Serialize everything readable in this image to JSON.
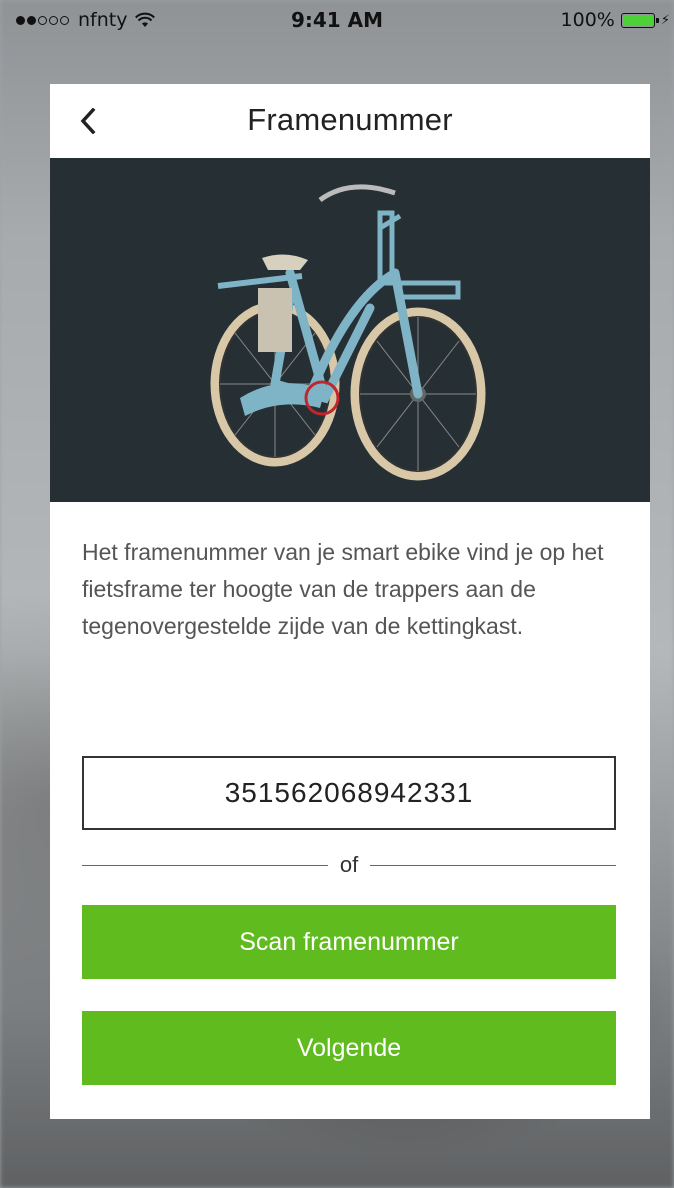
{
  "status_bar": {
    "carrier": "nfnty",
    "time": "9:41 AM",
    "battery": "100%",
    "signal_bars_filled": 2,
    "signal_bars_total": 5,
    "battery_level": 1.0,
    "icons": [
      "wifi-icon",
      "battery-icon",
      "charging-bolt-icon"
    ]
  },
  "header": {
    "back_icon": "chevron-left-icon",
    "title": "Framenummer"
  },
  "hero": {
    "image": "bike-photo",
    "highlight": "red-circle-marker"
  },
  "description": "Het framenummer van je smart ebike vind je op het fietsframe ter hoogte van de trappers aan de tegenovergestelde zijde van de kettingkast.",
  "form": {
    "frame_number_value": "351562068942331",
    "divider_label": "of",
    "scan_button_label": "Scan framenummer",
    "next_button_label": "Volgende"
  },
  "colors": {
    "accent": "#5fbb1e",
    "hero_bg": "#262f34",
    "bike": "#7fb3c6",
    "marker": "#c0272d"
  }
}
